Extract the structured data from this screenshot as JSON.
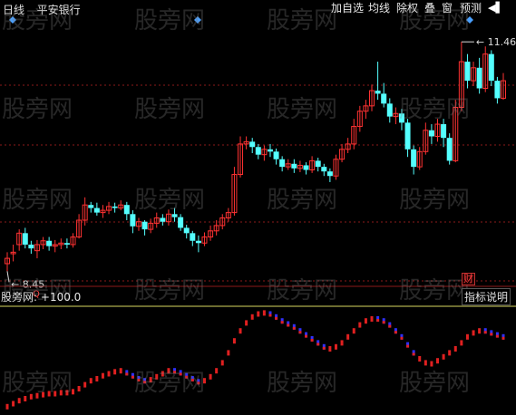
{
  "toolbar": {
    "title_period": "日线",
    "title_stock": "平安银行",
    "buttons": [
      "加自选",
      "均线",
      "除权",
      "叠",
      "窗",
      "预测"
    ],
    "nav_icon": "play-prev-icon"
  },
  "price_pane": {
    "high_label": "11.46",
    "low_label": "8.45",
    "low_marker": "Q",
    "finance_badge": "财",
    "colors": {
      "up": "#ff3232",
      "down": "#54ffff",
      "grid": "#8b1a1a"
    }
  },
  "indicator_pane": {
    "name": "股旁网",
    "value": "+100.0",
    "explain_button": "指标说明",
    "colors": {
      "up": "#e02020",
      "down": "#3030ff",
      "baseline": "#d8d860"
    }
  },
  "watermark": "股旁网",
  "chart_data": {
    "type": "candlestick",
    "price_range": [
      8.3,
      11.7
    ],
    "high": 11.46,
    "low": 8.45,
    "candles": [
      [
        8.55,
        8.62,
        8.45,
        8.7
      ],
      [
        8.68,
        8.7,
        8.58,
        8.8
      ],
      [
        8.8,
        8.95,
        8.72,
        9.0
      ],
      [
        8.95,
        8.8,
        8.75,
        9.02
      ],
      [
        8.8,
        8.75,
        8.68,
        8.85
      ],
      [
        8.72,
        8.8,
        8.62,
        8.86
      ],
      [
        8.8,
        8.85,
        8.74,
        8.9
      ],
      [
        8.85,
        8.78,
        8.72,
        8.9
      ],
      [
        8.78,
        8.8,
        8.7,
        8.86
      ],
      [
        8.8,
        8.82,
        8.74,
        8.88
      ],
      [
        8.82,
        8.8,
        8.75,
        8.88
      ],
      [
        8.8,
        8.9,
        8.76,
        8.95
      ],
      [
        8.9,
        9.12,
        8.88,
        9.2
      ],
      [
        9.12,
        9.32,
        9.05,
        9.42
      ],
      [
        9.32,
        9.28,
        9.22,
        9.36
      ],
      [
        9.28,
        9.22,
        9.18,
        9.35
      ],
      [
        9.22,
        9.25,
        9.15,
        9.32
      ],
      [
        9.25,
        9.3,
        9.2,
        9.36
      ],
      [
        9.3,
        9.28,
        9.22,
        9.35
      ],
      [
        9.28,
        9.32,
        9.25,
        9.38
      ],
      [
        9.32,
        9.2,
        9.12,
        9.36
      ],
      [
        9.2,
        9.04,
        8.95,
        9.25
      ],
      [
        9.04,
        9.1,
        8.98,
        9.15
      ],
      [
        9.1,
        9.0,
        8.92,
        9.12
      ],
      [
        9.0,
        9.08,
        8.95,
        9.14
      ],
      [
        9.08,
        9.15,
        9.02,
        9.22
      ],
      [
        9.15,
        9.1,
        9.05,
        9.2
      ],
      [
        9.1,
        9.2,
        9.05,
        9.26
      ],
      [
        9.2,
        9.16,
        9.1,
        9.28
      ],
      [
        9.16,
        9.02,
        8.98,
        9.2
      ],
      [
        9.02,
        8.95,
        8.88,
        9.06
      ],
      [
        8.95,
        8.85,
        8.78,
        8.98
      ],
      [
        8.85,
        8.82,
        8.7,
        8.92
      ],
      [
        8.82,
        8.9,
        8.78,
        8.96
      ],
      [
        8.9,
        8.98,
        8.85,
        9.05
      ],
      [
        8.98,
        9.05,
        8.92,
        9.12
      ],
      [
        9.05,
        9.15,
        9.0,
        9.2
      ],
      [
        9.15,
        9.22,
        9.1,
        9.28
      ],
      [
        9.22,
        9.72,
        9.18,
        9.82
      ],
      [
        9.72,
        10.12,
        9.68,
        10.22
      ],
      [
        10.12,
        10.15,
        10.05,
        10.22
      ],
      [
        10.15,
        10.08,
        10.0,
        10.2
      ],
      [
        10.08,
        9.98,
        9.92,
        10.12
      ],
      [
        9.98,
        10.05,
        9.9,
        10.1
      ],
      [
        10.05,
        10.02,
        9.95,
        10.12
      ],
      [
        10.02,
        9.92,
        9.85,
        10.06
      ],
      [
        9.92,
        9.82,
        9.76,
        9.96
      ],
      [
        9.82,
        9.86,
        9.78,
        9.92
      ],
      [
        9.86,
        9.8,
        9.74,
        9.92
      ],
      [
        9.8,
        9.84,
        9.75,
        9.9
      ],
      [
        9.84,
        9.78,
        9.72,
        9.88
      ],
      [
        9.78,
        9.9,
        9.74,
        9.96
      ],
      [
        9.9,
        9.82,
        9.76,
        9.94
      ],
      [
        9.82,
        9.76,
        9.7,
        9.86
      ],
      [
        9.76,
        9.7,
        9.62,
        9.8
      ],
      [
        9.7,
        9.92,
        9.65,
        9.98
      ],
      [
        9.92,
        10.05,
        9.88,
        10.12
      ],
      [
        10.05,
        10.12,
        10.0,
        10.2
      ],
      [
        10.12,
        10.35,
        10.05,
        10.45
      ],
      [
        10.35,
        10.55,
        10.28,
        10.62
      ],
      [
        10.55,
        10.62,
        10.45,
        10.7
      ],
      [
        10.62,
        10.82,
        10.55,
        10.9
      ],
      [
        10.82,
        10.78,
        10.7,
        11.2
      ],
      [
        10.78,
        10.65,
        10.6,
        10.92
      ],
      [
        10.65,
        10.48,
        10.4,
        10.72
      ],
      [
        10.48,
        10.52,
        10.38,
        10.6
      ],
      [
        10.52,
        10.4,
        10.3,
        10.58
      ],
      [
        10.4,
        10.05,
        9.95,
        10.45
      ],
      [
        10.05,
        9.82,
        9.72,
        10.1
      ],
      [
        9.82,
        10.02,
        9.78,
        10.08
      ],
      [
        10.02,
        10.3,
        9.98,
        10.4
      ],
      [
        10.3,
        10.22,
        10.12,
        10.38
      ],
      [
        10.22,
        10.38,
        10.15,
        10.45
      ],
      [
        10.38,
        10.2,
        10.08,
        10.45
      ],
      [
        10.2,
        9.9,
        9.85,
        10.26
      ],
      [
        9.9,
        10.6,
        9.88,
        10.7
      ],
      [
        10.6,
        11.2,
        10.55,
        11.46
      ],
      [
        11.2,
        10.95,
        10.85,
        11.3
      ],
      [
        10.95,
        11.12,
        10.88,
        11.2
      ],
      [
        11.12,
        10.85,
        10.78,
        11.25
      ],
      [
        10.85,
        11.3,
        10.8,
        11.4
      ],
      [
        11.3,
        10.95,
        10.88,
        11.35
      ],
      [
        10.95,
        10.72,
        10.65,
        11.0
      ],
      [
        10.72,
        10.95,
        10.7,
        11.05
      ]
    ],
    "indicator": {
      "up": [
        0.02,
        0.05,
        0.08,
        0.1,
        0.12,
        0.13,
        0.14,
        0.15,
        0.15,
        0.16,
        0.16,
        0.17,
        0.2,
        0.24,
        0.28,
        0.3,
        0.33,
        0.35,
        0.37,
        0.38,
        0.36,
        0.33,
        0.3,
        0.28,
        0.29,
        0.32,
        0.35,
        0.38,
        0.38,
        0.36,
        0.33,
        0.3,
        0.27,
        0.28,
        0.32,
        0.38,
        0.46,
        0.56,
        0.68,
        0.78,
        0.86,
        0.92,
        0.95,
        0.96,
        0.95,
        0.92,
        0.88,
        0.85,
        0.82,
        0.78,
        0.74,
        0.7,
        0.66,
        0.62,
        0.6,
        0.62,
        0.66,
        0.72,
        0.78,
        0.84,
        0.88,
        0.9,
        0.9,
        0.88,
        0.84,
        0.78,
        0.72,
        0.64,
        0.56,
        0.5,
        0.46,
        0.45,
        0.48,
        0.52,
        0.56,
        0.6,
        0.66,
        0.72,
        0.76,
        0.78,
        0.78,
        0.76,
        0.74,
        0.72
      ],
      "down_marks": [
        20,
        21,
        22,
        23,
        28,
        29,
        30,
        31,
        32,
        44,
        45,
        46,
        47,
        48,
        49,
        50,
        51,
        52,
        53,
        62,
        63,
        64,
        65,
        66,
        67,
        68,
        80,
        81,
        82,
        83
      ]
    }
  }
}
